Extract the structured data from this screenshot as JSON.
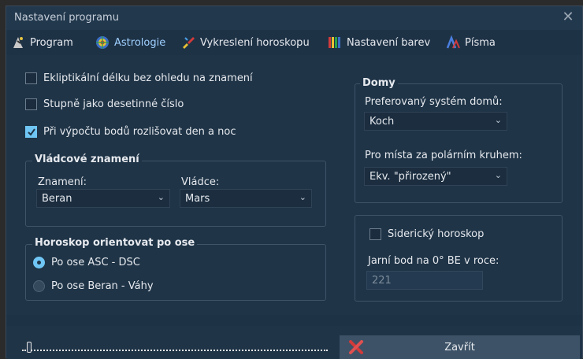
{
  "window": {
    "title": "Nastavení programu",
    "close_glyph": "✕"
  },
  "tabs": [
    {
      "label": "Program",
      "icon": "wizard-icon"
    },
    {
      "label": "Astrologie",
      "icon": "zodiac-wheel-icon"
    },
    {
      "label": "Vykreslení horoskopu",
      "icon": "paint-brush-icon"
    },
    {
      "label": "Nastavení barev",
      "icon": "color-palette-icon"
    },
    {
      "label": "Písma",
      "icon": "fonts-icon"
    }
  ],
  "active_tab": "Astrologie",
  "options": {
    "ecliptic": {
      "label": "Ekliptikální délku bez ohledu na znamení",
      "checked": false
    },
    "decimal": {
      "label": "Stupně jako desetinné číslo",
      "checked": false
    },
    "daynight": {
      "label": "Při výpočtu bodů rozlišovat den a noc",
      "checked": true
    }
  },
  "ruler": {
    "title": "Vládcové znamení",
    "sign_label": "Znamení:",
    "sign_value": "Beran",
    "ruler_label": "Vládce:",
    "ruler_value": "Mars"
  },
  "orientation": {
    "title": "Horoskop orientovat po ose",
    "options": [
      {
        "label": "Po ose ASC - DSC",
        "selected": true
      },
      {
        "label": "Po ose Beran - Váhy",
        "selected": false
      }
    ]
  },
  "houses": {
    "title": "Domy",
    "preferred_label": "Preferovaný systém domů:",
    "preferred_value": "Koch",
    "polar_label": "Pro místa za polárním kruhem:",
    "polar_value": "Ekv. \"přirozený\""
  },
  "sidereal": {
    "label": "Siderický horoskop",
    "checked": false,
    "year_label": "Jarní bod na 0° BE v roce:",
    "year_value": "221"
  },
  "bottom": {
    "close_label": "Zavřít",
    "progress": 0.02
  },
  "colors": {
    "accent": "#6fc6f5",
    "background": "#1f3447"
  }
}
